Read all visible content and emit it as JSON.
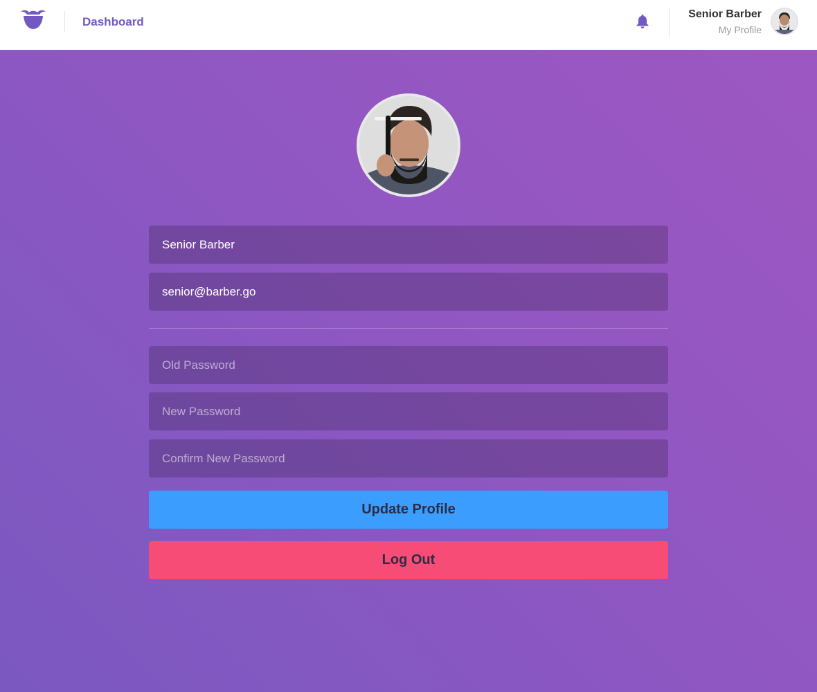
{
  "header": {
    "nav_label": "Dashboard",
    "user_name": "Senior Barber",
    "profile_link": "My Profile",
    "brand_color": "#7159c1",
    "icons": {
      "logo": "mustache-logo-icon",
      "notifications": "bell-icon"
    }
  },
  "profile": {
    "name_value": "Senior Barber",
    "email_value": "senior@barber.go",
    "old_password_placeholder": "Old Password",
    "new_password_placeholder": "New Password",
    "confirm_password_placeholder": "Confirm New Password",
    "update_label": "Update Profile",
    "logout_label": "Log Out",
    "colors": {
      "update": "#3b9eff",
      "logout": "#f64c75"
    }
  }
}
